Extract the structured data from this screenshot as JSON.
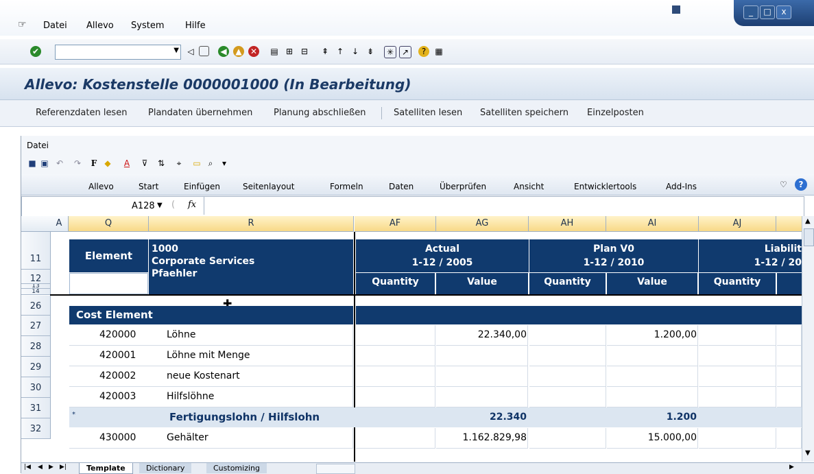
{
  "menubar": {
    "items": [
      {
        "label": "Datei"
      },
      {
        "label": "Allevo"
      },
      {
        "label": "System"
      },
      {
        "label": "Hilfe"
      }
    ]
  },
  "window_controls": {
    "minimize": "_",
    "maximize": "□",
    "close": "x"
  },
  "title": "Allevo: Kostenstelle 0000001000 (In Bearbeitung)",
  "app_toolbar": {
    "items": [
      {
        "label": "Referenzdaten lesen"
      },
      {
        "label": "Plandaten übernehmen"
      },
      {
        "label": "Planung abschließen"
      },
      {
        "label": "Satelliten lesen"
      },
      {
        "label": "Satelliten speichern"
      },
      {
        "label": "Einzelposten"
      }
    ]
  },
  "excel": {
    "menu": "Datei",
    "ribbon_tabs": [
      {
        "label": "Allevo"
      },
      {
        "label": "Start"
      },
      {
        "label": "Einfügen"
      },
      {
        "label": "Seitenlayout"
      },
      {
        "label": "Formeln"
      },
      {
        "label": "Daten"
      },
      {
        "label": "Überprüfen"
      },
      {
        "label": "Ansicht"
      },
      {
        "label": "Entwicklertools"
      },
      {
        "label": "Add-Ins"
      }
    ],
    "name_box": "A128",
    "fx": "fx",
    "columns": [
      "A",
      "Q",
      "R",
      "AF",
      "AG",
      "AH",
      "AI",
      "AJ"
    ],
    "header": {
      "element_label": "Element",
      "element_lines": [
        "1000",
        "Corporate Services",
        "Pfaehler"
      ],
      "actual_title": "Actual",
      "actual_period": "1-12 / 2005",
      "plan_title": "Plan V0",
      "plan_period": "1-12 / 2010",
      "liab_title": "Liabilit",
      "liab_period": "1-12 / 20",
      "quantity": "Quantity",
      "value": "Value"
    },
    "row_numbers": [
      "11",
      "12",
      "13",
      "14",
      "26",
      "27",
      "28",
      "29",
      "30",
      "31",
      "32"
    ],
    "cost_element_label": "Cost Element",
    "rows": [
      {
        "row": "27",
        "code": "420000",
        "name": "Löhne",
        "actual_value": "22.340,00",
        "plan_value": "1.200,00"
      },
      {
        "row": "28",
        "code": "420001",
        "name": "Löhne mit Menge",
        "actual_value": "",
        "plan_value": ""
      },
      {
        "row": "29",
        "code": "420002",
        "name": "neue Kostenart",
        "actual_value": "",
        "plan_value": ""
      },
      {
        "row": "30",
        "code": "420003",
        "name": "Hilfslöhne",
        "actual_value": "",
        "plan_value": ""
      }
    ],
    "subtotal": {
      "marker": "*",
      "name": "Fertigungslohn / Hilfslohn",
      "actual_value": "22.340",
      "plan_value": "1.200"
    },
    "row32": {
      "code": "430000",
      "name": "Gehälter",
      "actual_value": "1.162.829,98",
      "plan_value": "15.000,00"
    },
    "sheet_tabs": [
      {
        "label": "Template"
      },
      {
        "label": "Dictionary"
      },
      {
        "label": "Customizing"
      }
    ]
  }
}
